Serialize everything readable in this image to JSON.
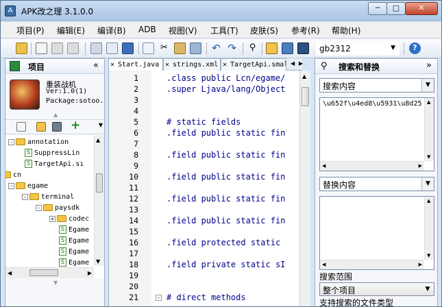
{
  "window": {
    "title": "APK改之理 3.1.0.0",
    "min": "─",
    "max": "□",
    "close": "✕"
  },
  "menu": [
    "项目(P)",
    "编辑(E)",
    "编译(B)",
    "ADB",
    "视图(V)",
    "工具(T)",
    "皮肤(S)",
    "参考(R)",
    "帮助(H)"
  ],
  "toolbar": {
    "encoding": "gb2312"
  },
  "project": {
    "title": "项目",
    "collapse": "«",
    "app_name": "重装战机",
    "version": "Ver:1.0(1)",
    "package": "Package:sotoo."
  },
  "tree": [
    {
      "label": "annotation",
      "type": "folder",
      "expander": "-"
    },
    {
      "label": "SuppressLin",
      "type": "file"
    },
    {
      "label": "TargetApi.sı",
      "type": "file"
    },
    {
      "label": "cn",
      "type": "folder",
      "expander": ""
    },
    {
      "label": "egame",
      "type": "folder",
      "expander": "-"
    },
    {
      "label": "terminal",
      "type": "folder",
      "expander": "-"
    },
    {
      "label": "paysdk",
      "type": "folder",
      "expander": "-"
    },
    {
      "label": "codec",
      "type": "folder",
      "expander": "+"
    },
    {
      "label": "Egame",
      "type": "file"
    },
    {
      "label": "Egame",
      "type": "file"
    },
    {
      "label": "Egame",
      "type": "file"
    },
    {
      "label": "Egame",
      "type": "file"
    }
  ],
  "tabs": [
    "Start.java",
    "strings.xml",
    "TargetApi.smali"
  ],
  "editor": {
    "lines": [
      {
        "n": "1",
        "text": ".class public Lcn/egame/"
      },
      {
        "n": "2",
        "text": ".super Ljava/lang/Object"
      },
      {
        "n": "3",
        "text": ""
      },
      {
        "n": "4",
        "text": ""
      },
      {
        "n": "5",
        "text": "# static fields"
      },
      {
        "n": "6",
        "text": ".field public static fin"
      },
      {
        "n": "7",
        "text": ""
      },
      {
        "n": "8",
        "text": ".field public static fin"
      },
      {
        "n": "9",
        "text": ""
      },
      {
        "n": "10",
        "text": ".field public static fin"
      },
      {
        "n": "11",
        "text": ""
      },
      {
        "n": "12",
        "text": ".field public static fin"
      },
      {
        "n": "13",
        "text": ""
      },
      {
        "n": "14",
        "text": ".field public static fin"
      },
      {
        "n": "15",
        "text": ""
      },
      {
        "n": "16",
        "text": ".field protected static"
      },
      {
        "n": "17",
        "text": ""
      },
      {
        "n": "18",
        "text": ".field private static sI"
      },
      {
        "n": "19",
        "text": ""
      },
      {
        "n": "20",
        "text": ""
      },
      {
        "n": "21",
        "text": "# direct methods"
      }
    ]
  },
  "search": {
    "title": "搜索和替换",
    "collapse": "»",
    "search_label": "搜索内容",
    "search_text": "\\u652f\\u4ed8\\u5931\\u8d25",
    "replace_label": "替换内容",
    "scope_label": "搜索范围",
    "scope_value": "整个项目",
    "filetypes_label": "支持搜索的文件类型"
  }
}
